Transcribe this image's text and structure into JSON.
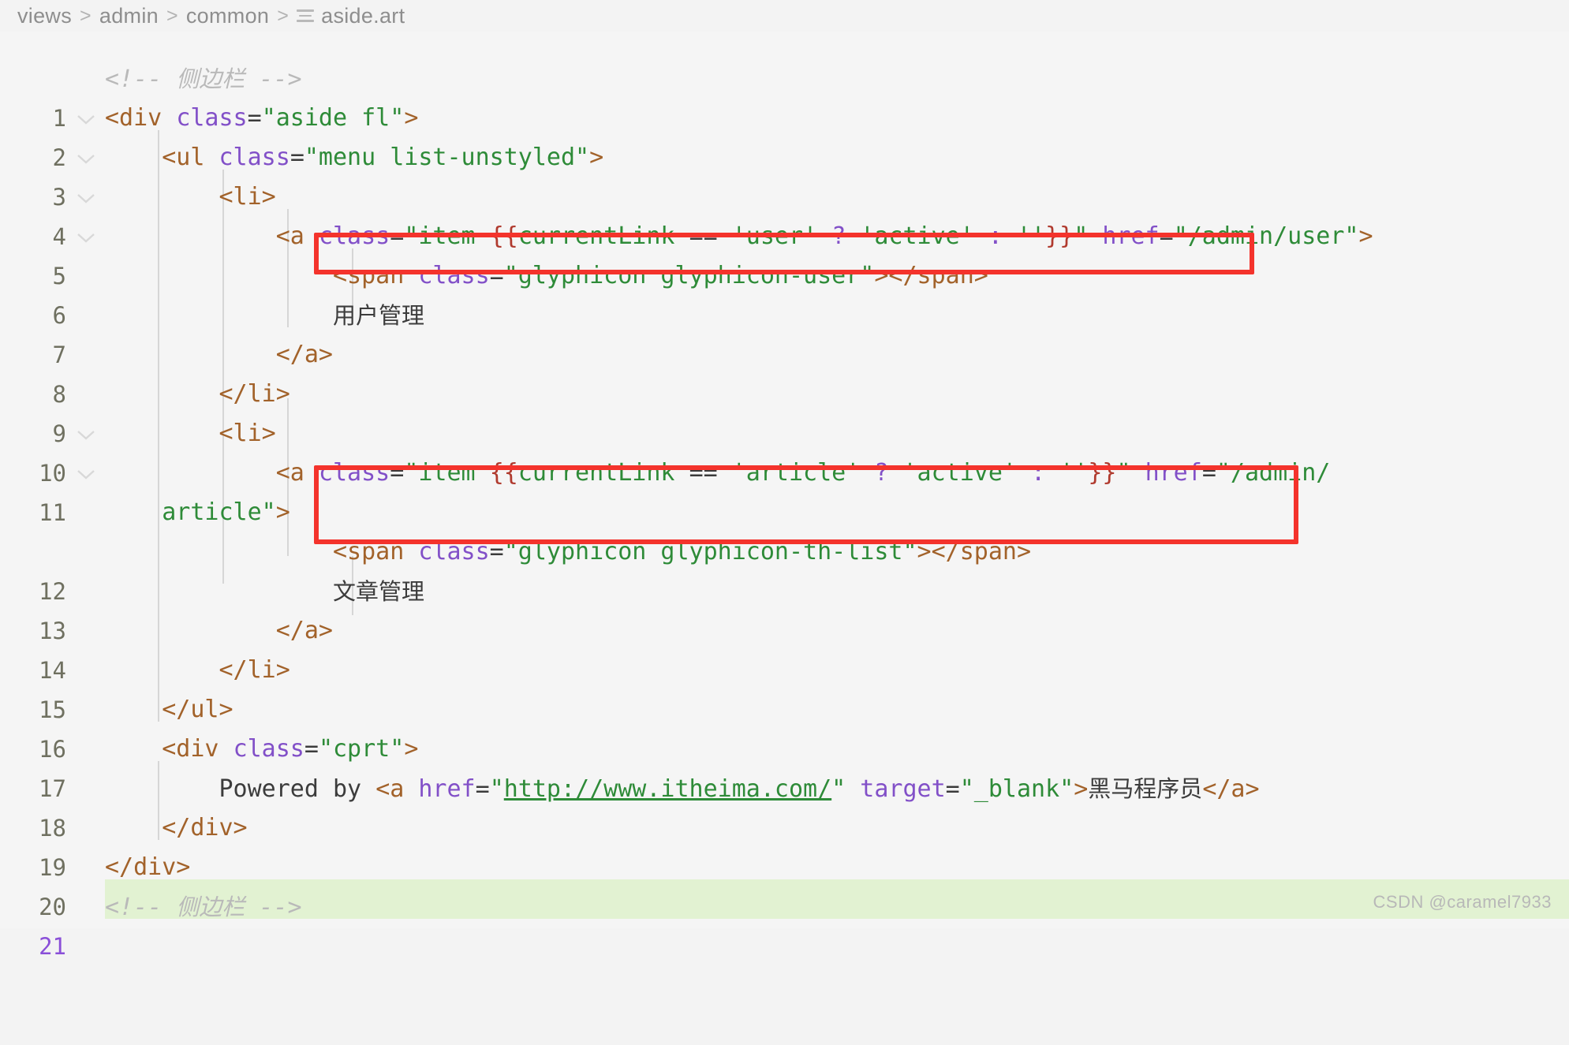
{
  "breadcrumb": {
    "items": [
      "views",
      "admin",
      "common"
    ],
    "separator": ">",
    "file_icon": "file-lines-icon",
    "filename": "aside.art"
  },
  "editor": {
    "language": "html",
    "colors": {
      "background": "#f5f5f5",
      "tag": "#a2622a",
      "attribute": "#8250c8",
      "string": "#2e8b38",
      "comment": "#b9b9b9",
      "text": "#3c3c3c",
      "mustache": "#b03a2e",
      "line_number": "#6f7060",
      "added_line_number": "#8a4fd8",
      "added_line_background": "#e2f2d2",
      "annotation_box": "#f4332c",
      "indent_guide": "#d6d6d6"
    },
    "lines": [
      {
        "n": "1",
        "text": "<!-- 侧边栏 -->"
      },
      {
        "n": "2",
        "text": "<div class=\"aside fl\">"
      },
      {
        "n": "3",
        "text": "    <ul class=\"menu list-unstyled\">"
      },
      {
        "n": "4",
        "text": "        <li>"
      },
      {
        "n": "5",
        "text": "            <a class=\"item {{currentLink == 'user' ? 'active' : ''}}\" href=\"/admin/user\">"
      },
      {
        "n": "6",
        "text": "                <span class=\"glyphicon glyphicon-user\"></span>"
      },
      {
        "n": "7",
        "text": "                用户管理"
      },
      {
        "n": "8",
        "text": "            </a>"
      },
      {
        "n": "9",
        "text": "        </li>"
      },
      {
        "n": "10",
        "text": "        <li>"
      },
      {
        "n": "11",
        "text": "            <a class=\"item {{currentLink == 'article' ? 'active' : ''}}\" href=\"/admin/article\">"
      },
      {
        "n": "12",
        "text": "                <span class=\"glyphicon glyphicon-th-list\"></span>"
      },
      {
        "n": "13",
        "text": "                文章管理"
      },
      {
        "n": "14",
        "text": "            </a>"
      },
      {
        "n": "15",
        "text": "        </li>"
      },
      {
        "n": "16",
        "text": "    </ul>"
      },
      {
        "n": "17",
        "text": "    <div class=\"cprt\">"
      },
      {
        "n": "18",
        "text": "        Powered by <a href=\"http://www.itheima.com/\" target=\"_blank\">黑马程序员</a>"
      },
      {
        "n": "19",
        "text": "    </div>"
      },
      {
        "n": "20",
        "text": "</div>"
      },
      {
        "n": "21",
        "text": "<!-- 侧边栏 -->"
      }
    ],
    "fold_chevron_lines": [
      "2",
      "3",
      "4",
      "5",
      "10",
      "11"
    ],
    "added_lines": [
      "21"
    ],
    "annotations": [
      {
        "label": "class-expression-user",
        "line": "5",
        "content": "<a class=\"item {{currentLink == 'user' ? 'active' : ''}}\""
      },
      {
        "label": "class-expression-article",
        "line": "11",
        "content": "<a class=\"item {{currentLink == 'article' ? 'active' : ''}}\""
      }
    ]
  },
  "watermark": {
    "text": "CSDN @caramel7933"
  }
}
